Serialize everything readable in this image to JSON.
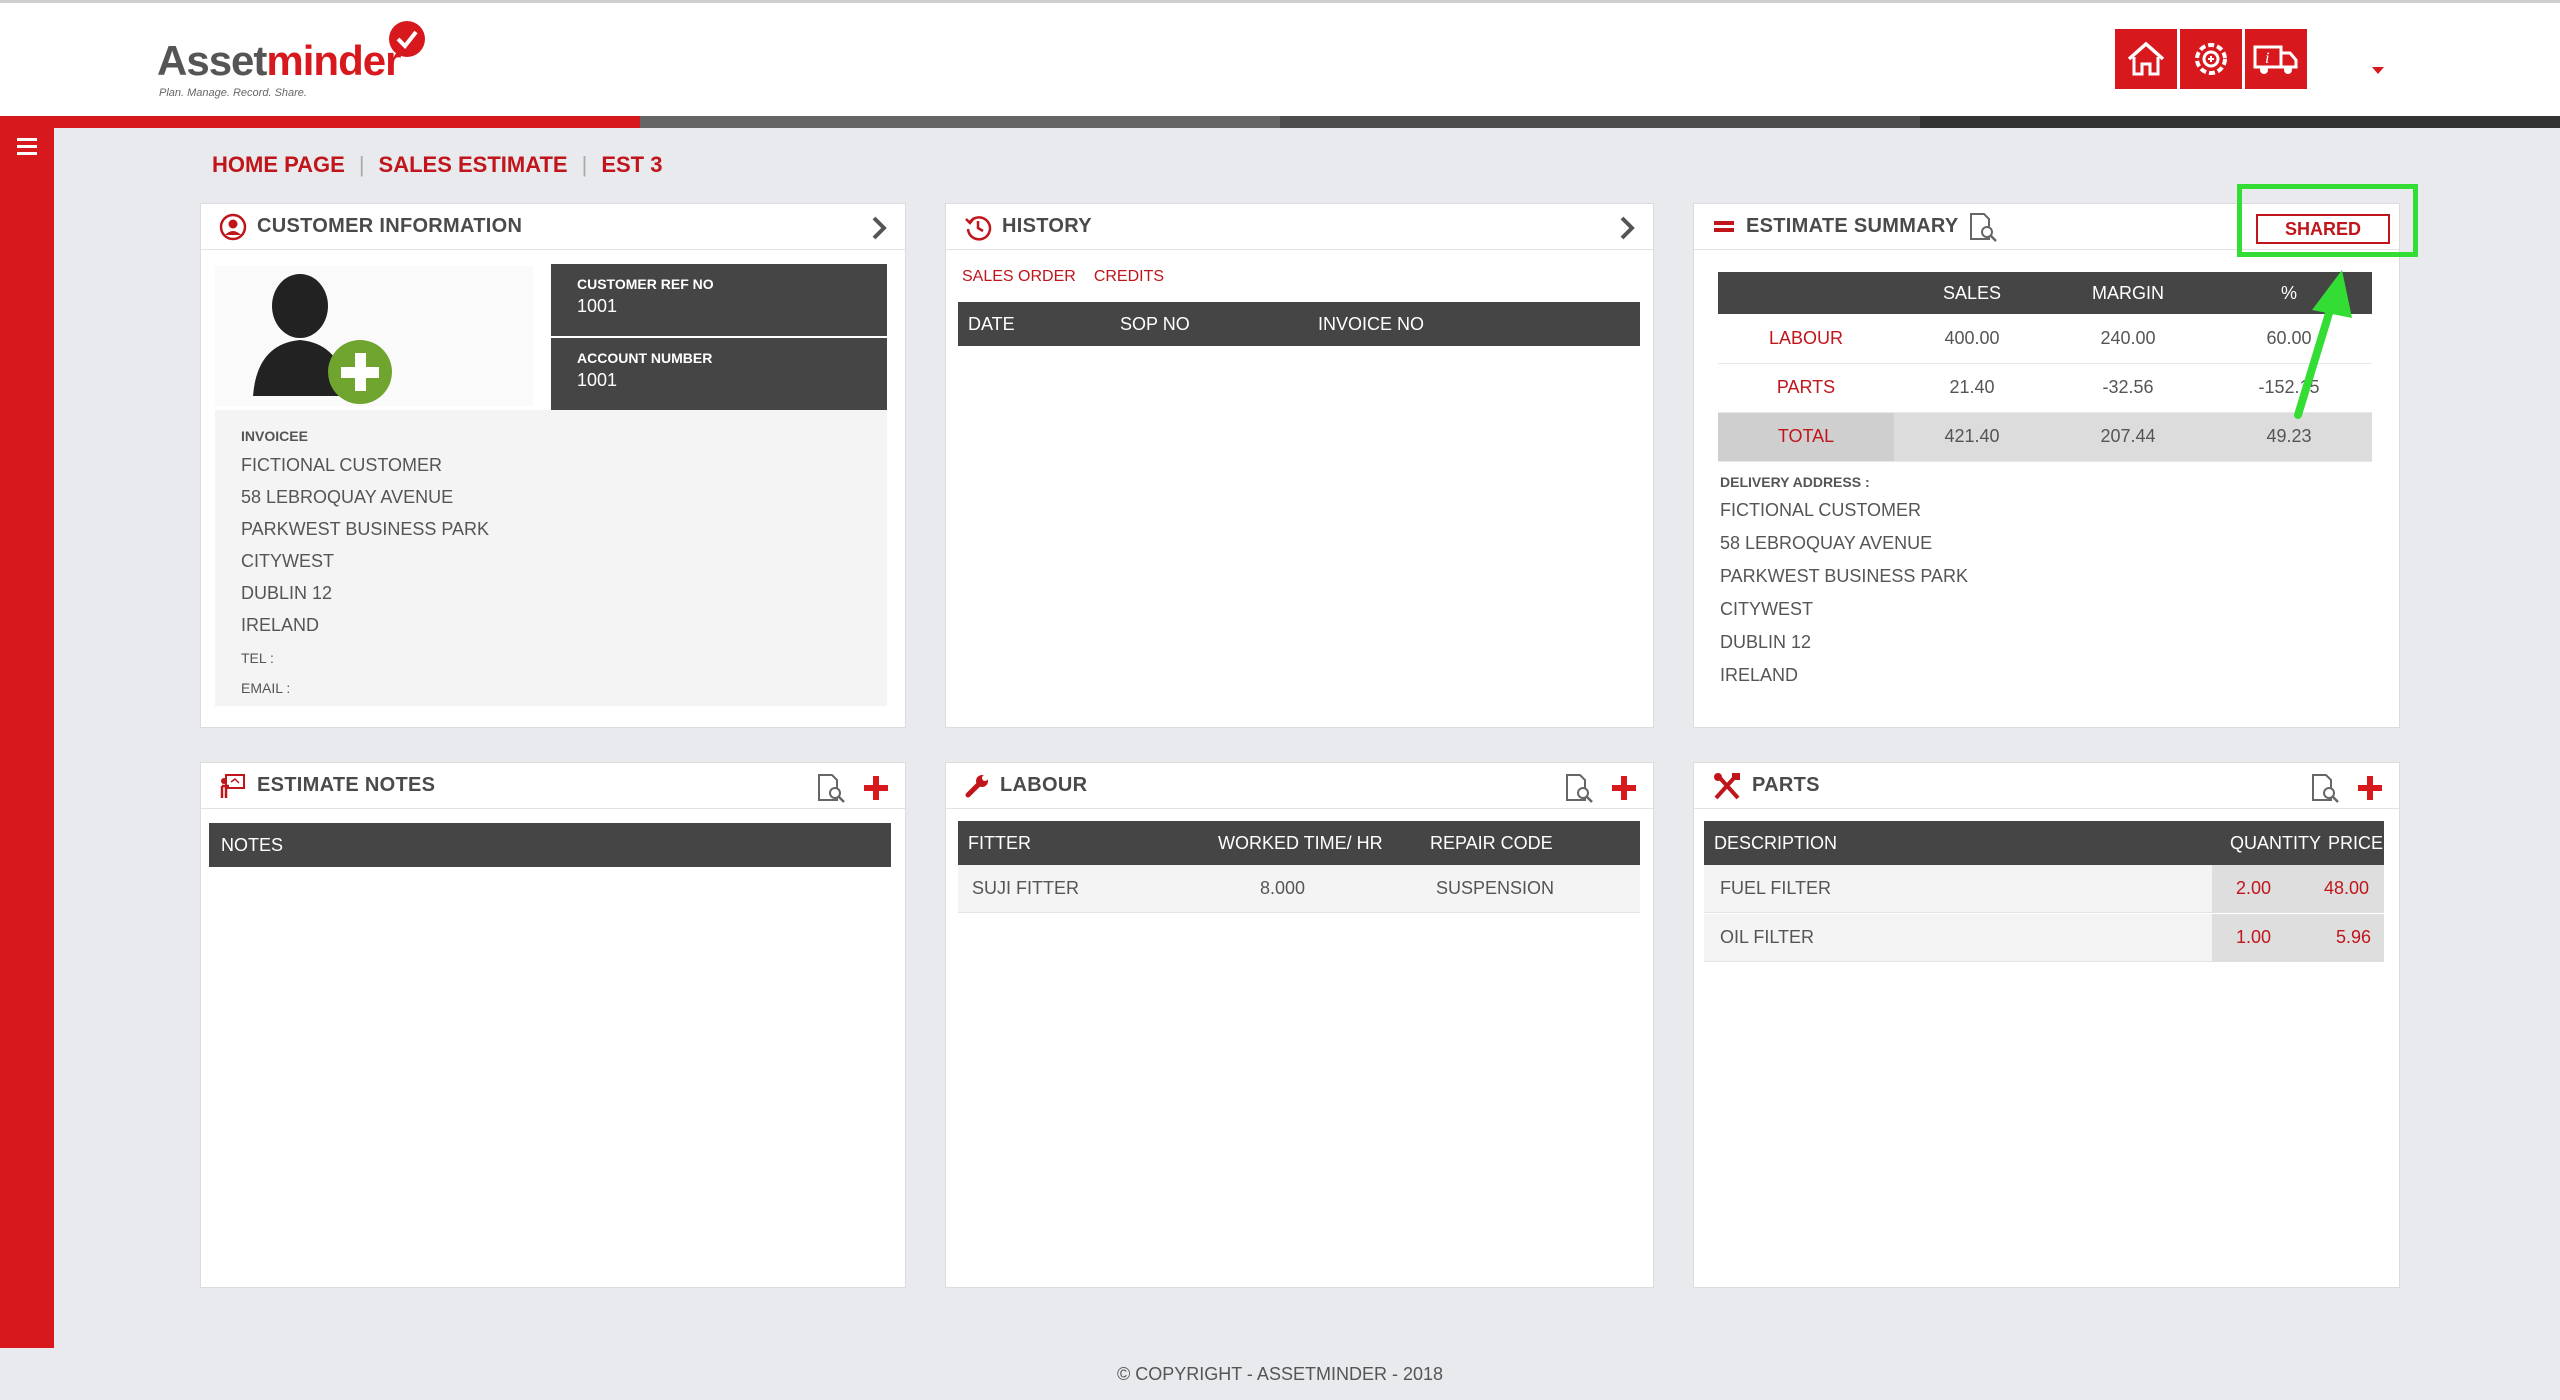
{
  "brand": {
    "name_part1": "Asset",
    "name_part2": "minder",
    "tagline": "Plan. Manage. Record. Share."
  },
  "colors": {
    "accent": "#d7191e",
    "dark": "#454545",
    "highlight": "#33dd33"
  },
  "top_icons": [
    "home-icon",
    "service-gear-icon",
    "vehicle-info-icon"
  ],
  "breadcrumb": [
    "HOME PAGE",
    "SALES ESTIMATE",
    "EST 3"
  ],
  "customer": {
    "title": "CUSTOMER INFORMATION",
    "ref_label": "CUSTOMER REF NO",
    "ref_value": "1001",
    "account_label": "ACCOUNT NUMBER",
    "account_value": "1001",
    "invoicee_label": "INVOICEE",
    "address": [
      "FICTIONAL CUSTOMER",
      "58 LEBROQUAY AVENUE",
      "PARKWEST BUSINESS PARK",
      "CITYWEST",
      "DUBLIN 12",
      "IRELAND"
    ],
    "tel_label": "TEL :",
    "email_label": "EMAIL :"
  },
  "history": {
    "title": "HISTORY",
    "tabs": [
      "SALES ORDER",
      "CREDITS"
    ],
    "columns": [
      "DATE",
      "SOP NO",
      "INVOICE NO"
    ]
  },
  "summary": {
    "title": "ESTIMATE SUMMARY",
    "shared_label": "SHARED",
    "columns": [
      "",
      "SALES",
      "MARGIN",
      "%"
    ],
    "rows": [
      {
        "label": "LABOUR",
        "sales": "400.00",
        "margin": "240.00",
        "pct": "60.00"
      },
      {
        "label": "PARTS",
        "sales": "21.40",
        "margin": "-32.56",
        "pct": "-152.15"
      },
      {
        "label": "TOTAL",
        "sales": "421.40",
        "margin": "207.44",
        "pct": "49.23"
      }
    ],
    "delivery_label": "DELIVERY ADDRESS :",
    "delivery": [
      "FICTIONAL CUSTOMER",
      "58 LEBROQUAY AVENUE",
      "PARKWEST BUSINESS PARK",
      "CITYWEST",
      "DUBLIN 12",
      "IRELAND"
    ]
  },
  "notes": {
    "title": "ESTIMATE NOTES",
    "column": "NOTES"
  },
  "labour": {
    "title": "LABOUR",
    "columns": [
      "FITTER",
      "WORKED TIME/ HR",
      "REPAIR CODE"
    ],
    "rows": [
      {
        "fitter": "SUJI FITTER",
        "time": "8.000",
        "code": "SUSPENSION"
      }
    ]
  },
  "parts": {
    "title": "PARTS",
    "columns": [
      "DESCRIPTION",
      "QUANTITY",
      "PRICE"
    ],
    "rows": [
      {
        "desc": "FUEL FILTER",
        "qty": "2.00",
        "price": "48.00"
      },
      {
        "desc": "OIL FILTER",
        "qty": "1.00",
        "price": "5.96"
      }
    ]
  },
  "footer": "© COPYRIGHT - ASSETMINDER - 2018"
}
